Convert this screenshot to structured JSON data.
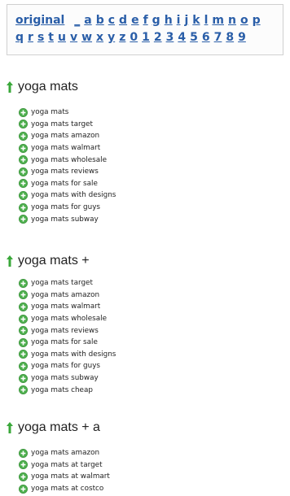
{
  "alphabet": {
    "original_label": "original",
    "row1": [
      "_",
      "a",
      "b",
      "c",
      "d",
      "e",
      "f",
      "g",
      "h",
      "i",
      "j",
      "k",
      "l",
      "m",
      "n",
      "o",
      "p"
    ],
    "row2": [
      "q",
      "r",
      "s",
      "t",
      "u",
      "v",
      "w",
      "x",
      "y",
      "z",
      "0",
      "1",
      "2",
      "3",
      "4",
      "5",
      "6",
      "7",
      "8",
      "9"
    ]
  },
  "colors": {
    "link": "#2a5ea8",
    "arrow": "#3aa83a",
    "plus_icon": "#4cae4c"
  },
  "sections": [
    {
      "title": "yoga mats",
      "items": [
        "yoga mats",
        "yoga mats target",
        "yoga mats amazon",
        "yoga mats walmart",
        "yoga mats wholesale",
        "yoga mats reviews",
        "yoga mats for sale",
        "yoga mats with designs",
        "yoga mats for guys",
        "yoga mats subway"
      ]
    },
    {
      "title": "yoga mats +",
      "items": [
        "yoga mats target",
        "yoga mats amazon",
        "yoga mats walmart",
        "yoga mats wholesale",
        "yoga mats reviews",
        "yoga mats for sale",
        "yoga mats with designs",
        "yoga mats for guys",
        "yoga mats subway",
        "yoga mats cheap"
      ]
    },
    {
      "title": "yoga mats + a",
      "items": [
        "yoga mats amazon",
        "yoga mats at target",
        "yoga mats at walmart",
        "yoga mats at costco"
      ]
    }
  ]
}
